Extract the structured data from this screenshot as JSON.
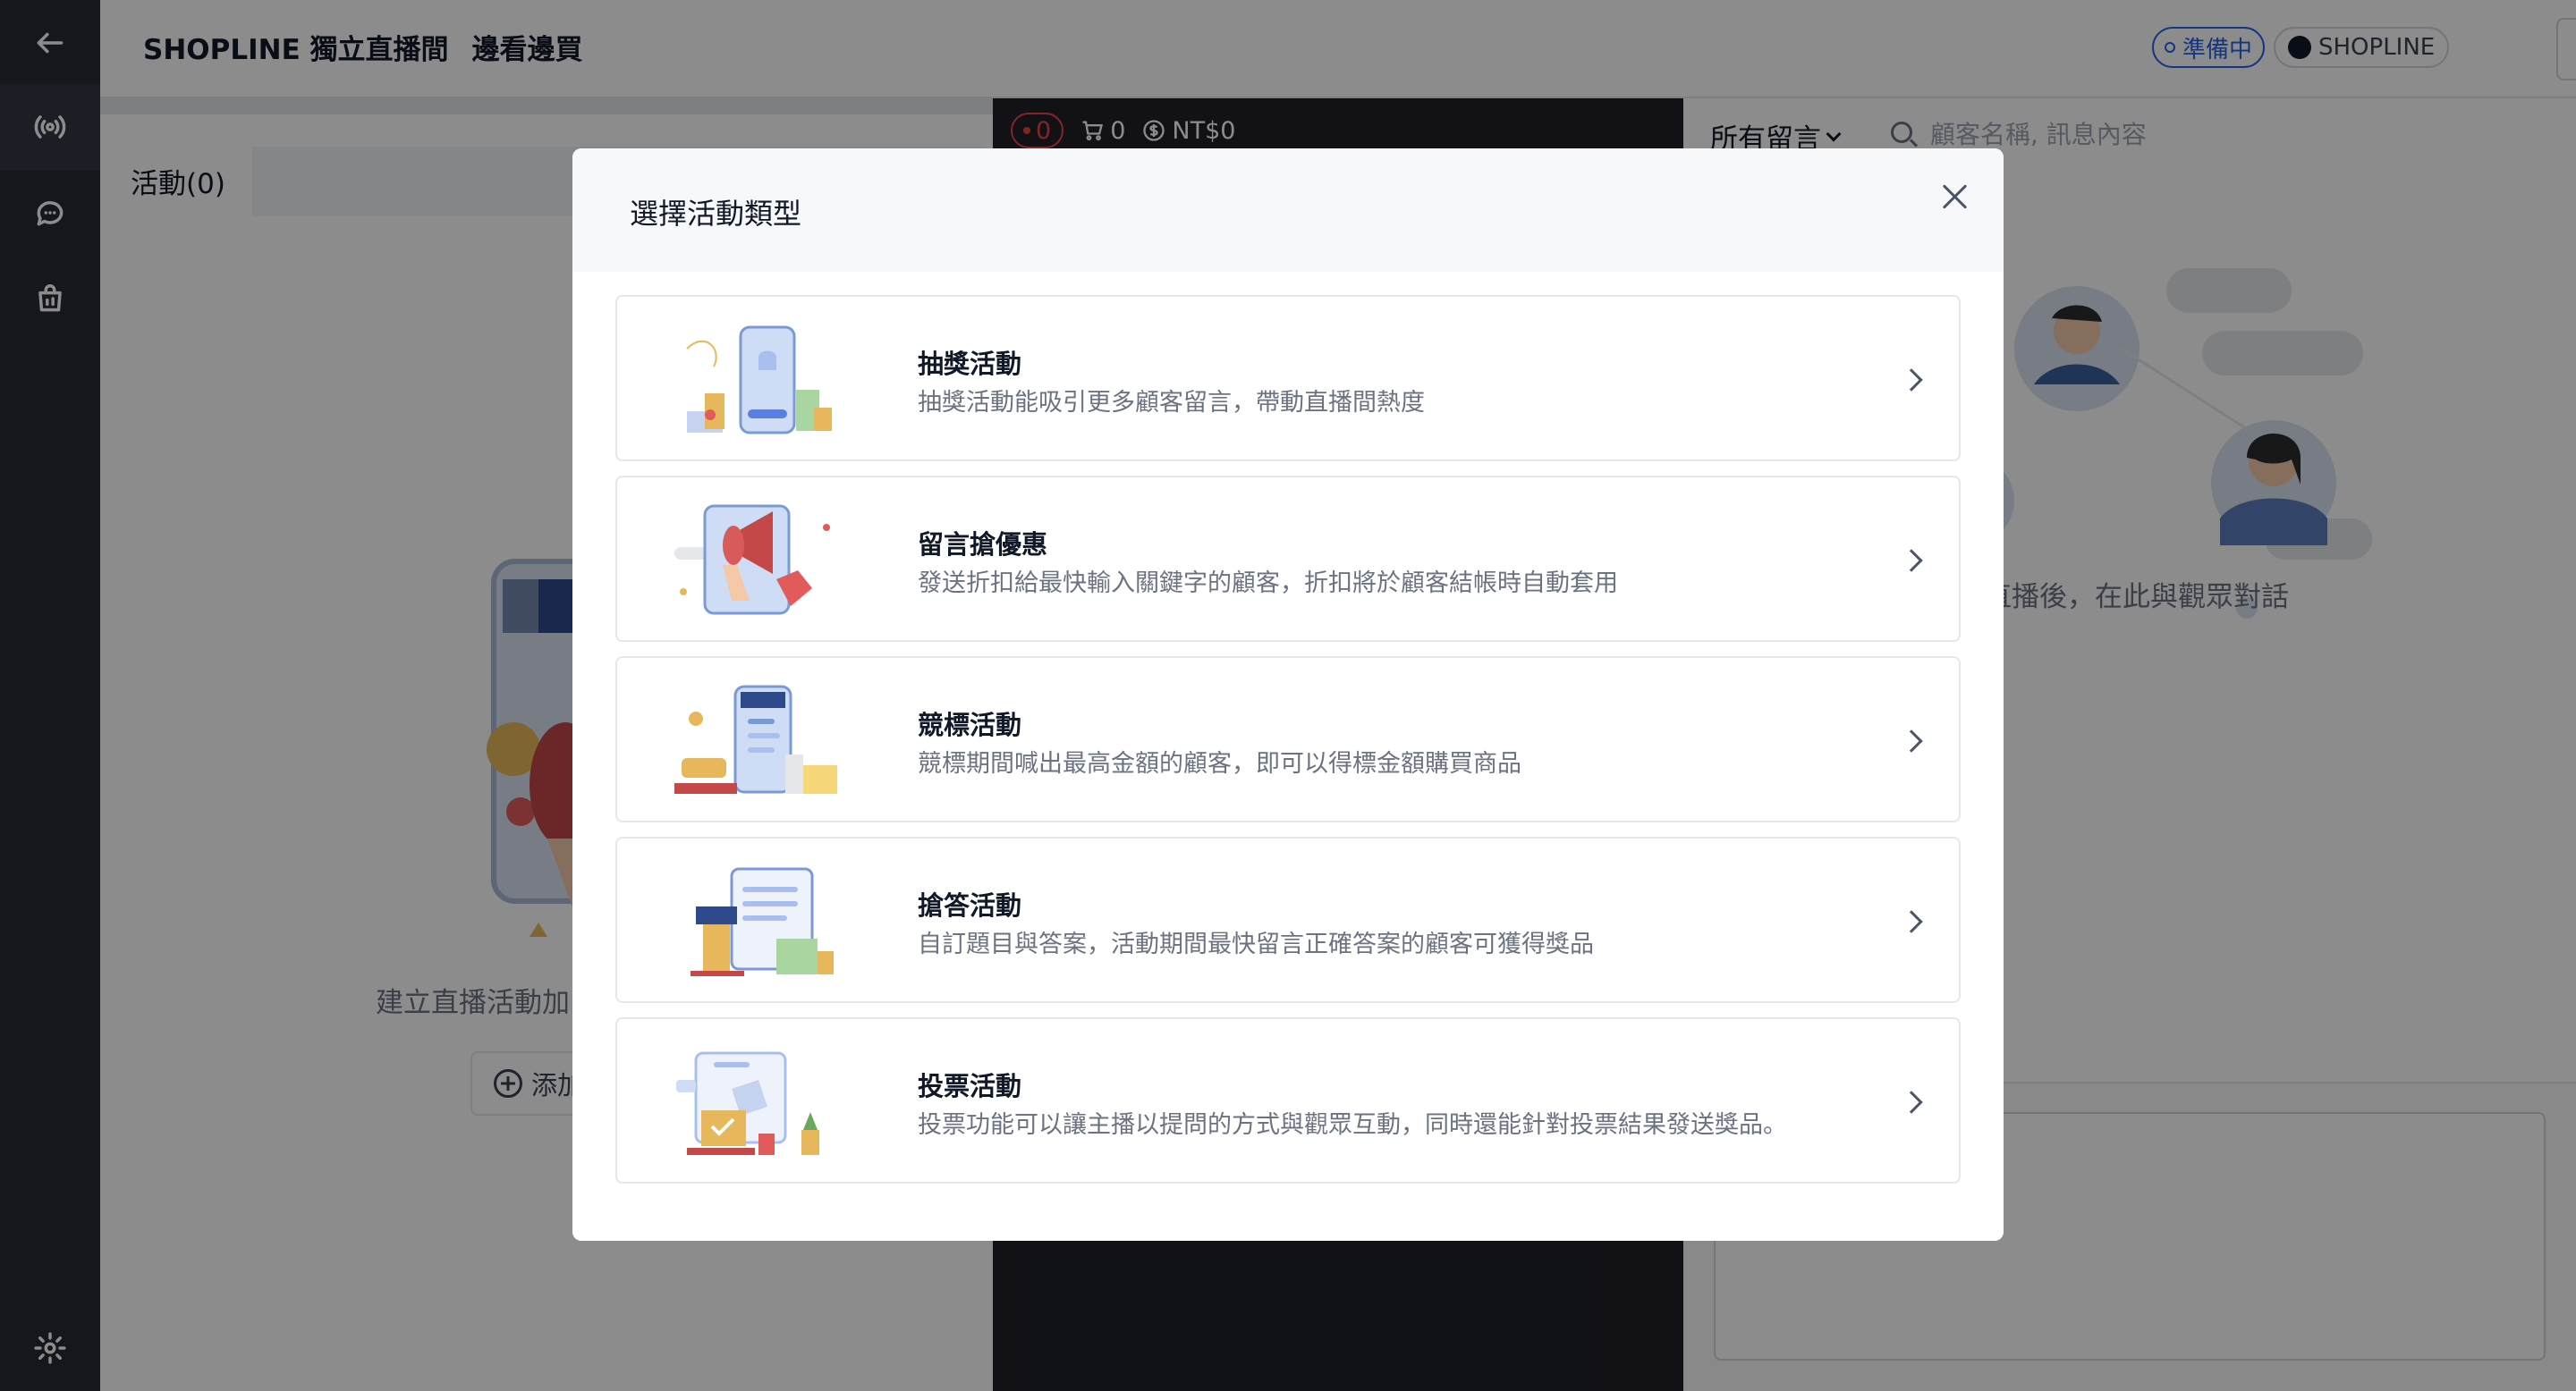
{
  "header": {
    "title_main": "SHOPLINE 獨立直播間",
    "title_sub": "邊看邊買",
    "status": "準備中",
    "brand": "SHOPLINE"
  },
  "activity_panel": {
    "tab_label": "活動(0)",
    "empty_text": "建立直播活動加",
    "add_label": "添加"
  },
  "video": {
    "viewers": "0",
    "cart_count": "0",
    "revenue": "NT$0"
  },
  "comments": {
    "filter_label": "所有留言",
    "search_placeholder": "顧客名稱, 訊息內容",
    "empty_hint": "直播後，在此與觀眾對話"
  },
  "modal": {
    "title": "選擇活動類型",
    "options": [
      {
        "title": "抽獎活動",
        "description": "抽獎活動能吸引更多顧客留言，帶動直播間熱度"
      },
      {
        "title": "留言搶優惠",
        "description": "發送折扣給最快輸入關鍵字的顧客，折扣將於顧客結帳時自動套用"
      },
      {
        "title": "競標活動",
        "description": "競標期間喊出最高金額的顧客，即可以得標金額購買商品"
      },
      {
        "title": "搶答活動",
        "description": "自訂題目與答案，活動期間最快留言正確答案的顧客可獲得獎品"
      },
      {
        "title": "投票活動",
        "description": "投票功能可以讓主播以提問的方式與觀眾互動，同時還能針對投票結果發送獎品。"
      }
    ]
  },
  "colors": {
    "rail": "#272a35",
    "accent": "#2563eb",
    "live": "#ef4444"
  }
}
